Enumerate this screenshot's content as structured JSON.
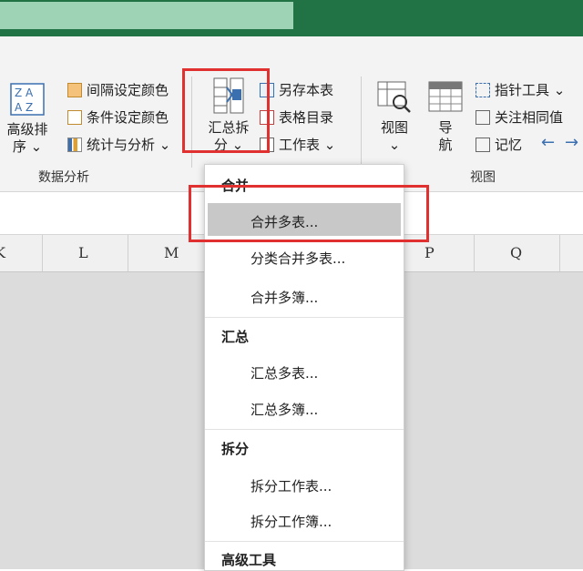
{
  "ribbon": {
    "sort": {
      "line1": "高级排",
      "line2": "序 ⌄"
    },
    "data_group": {
      "items": [
        "间隔设定颜色",
        "条件设定颜色",
        "统计与分析 ⌄"
      ],
      "label": "数据分析"
    },
    "merge_button": {
      "line1": "汇总拆",
      "line2": "分 ⌄"
    },
    "table_items": [
      "另存本表",
      "表格目录",
      "工作表 ⌄"
    ],
    "view_button": {
      "line1": "视图",
      "line2": "⌄"
    },
    "nav_button": {
      "line1": "导",
      "line2": "航"
    },
    "view_items": [
      "指针工具 ⌄",
      "关注相同值",
      "记忆"
    ],
    "view_group_label": "视图"
  },
  "columns": [
    "K",
    "L",
    "M",
    "P",
    "Q"
  ],
  "menu": {
    "sections": [
      {
        "title": "合并",
        "items": [
          "合并多表...",
          "分类合并多表...",
          "合并多簿..."
        ]
      },
      {
        "title": "汇总",
        "items": [
          "汇总多表...",
          "汇总多簿..."
        ]
      },
      {
        "title": "拆分",
        "items": [
          "拆分工作表...",
          "拆分工作簿..."
        ]
      },
      {
        "title": "高级工具",
        "items": []
      }
    ]
  },
  "colors": {
    "title_bar": "#217346",
    "highlight": "#e03030",
    "selected": "#c8c8c8"
  }
}
